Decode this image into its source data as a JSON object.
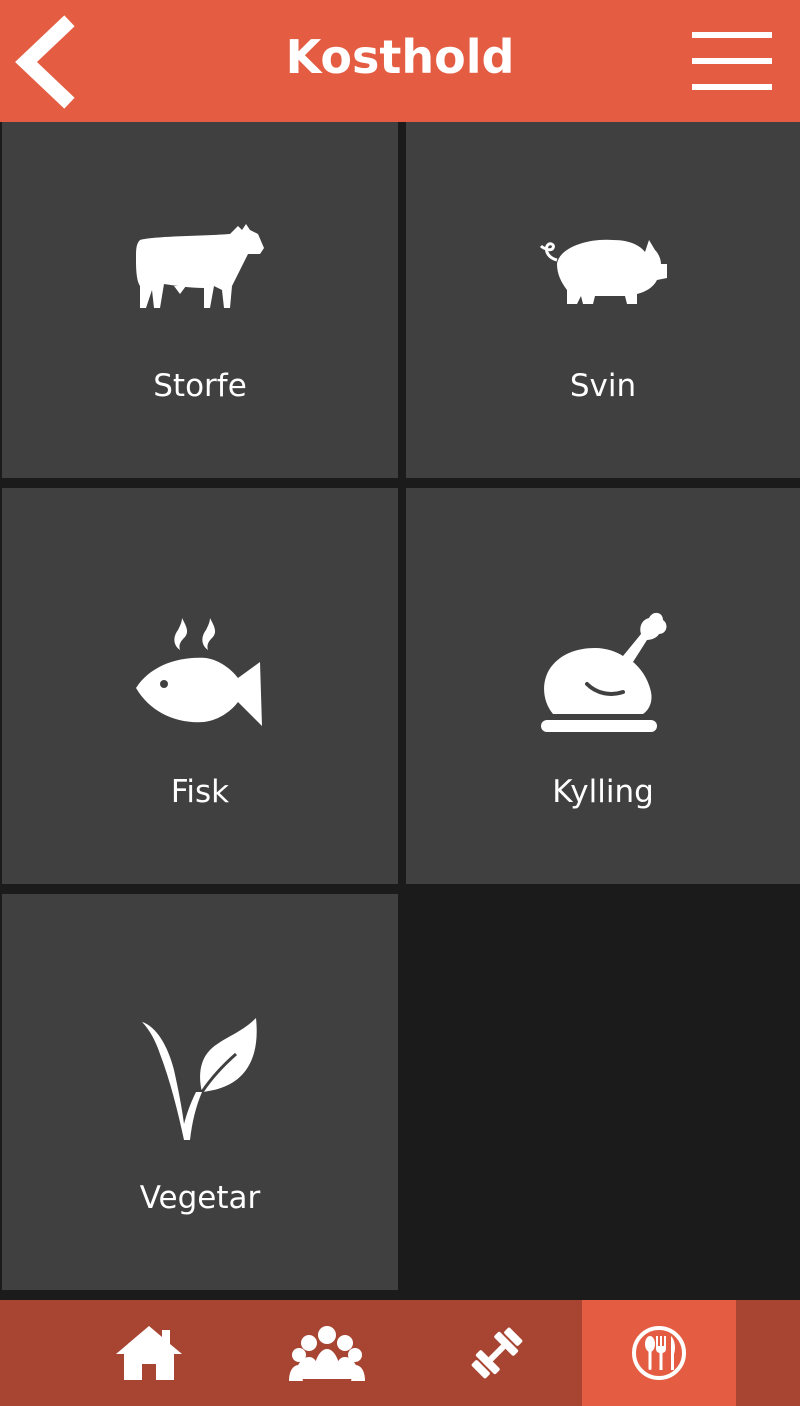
{
  "header": {
    "title": "Kosthold",
    "back_icon": "chevron-left-icon",
    "menu_icon": "hamburger-menu-icon"
  },
  "categories": [
    {
      "label": "Storfe",
      "icon": "cow-icon"
    },
    {
      "label": "Svin",
      "icon": "pig-icon"
    },
    {
      "label": "Fisk",
      "icon": "fish-icon"
    },
    {
      "label": "Kylling",
      "icon": "chicken-icon"
    },
    {
      "label": "Vegetar",
      "icon": "vegetarian-leaf-icon"
    }
  ],
  "tabbar": {
    "tabs": [
      {
        "icon": "home-icon",
        "active": false
      },
      {
        "icon": "group-icon",
        "active": false
      },
      {
        "icon": "dumbbell-icon",
        "active": false
      },
      {
        "icon": "fork-knife-icon",
        "active": true
      }
    ]
  },
  "colors": {
    "accent": "#e45d43",
    "accent_dark": "#a84532",
    "tile": "#404040",
    "background": "#1b1b1b",
    "text": "#ffffff"
  }
}
